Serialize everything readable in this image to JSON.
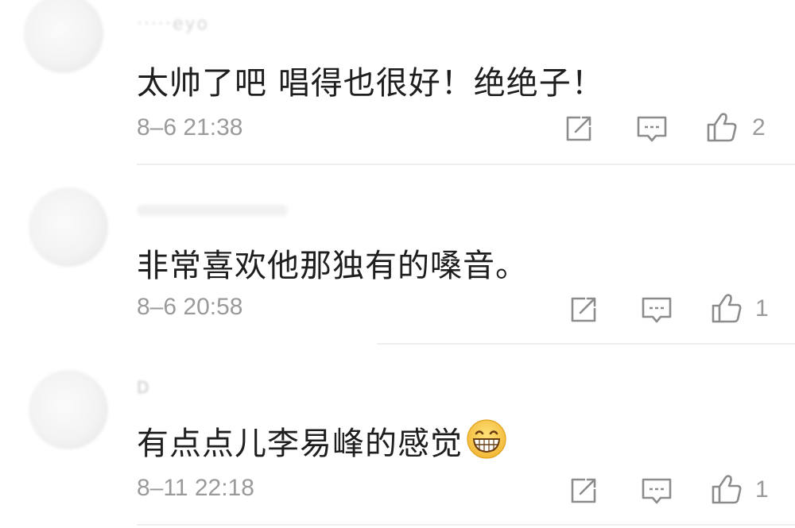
{
  "comments": [
    {
      "username": "·····eyo",
      "text": "太帅了吧 唱得也很好！绝绝子！",
      "timestamp": "8–6 21:38",
      "likes": "2",
      "emoji": null
    },
    {
      "username": "",
      "text": "非常喜欢他那独有的嗓音。",
      "timestamp": "8–6 20:58",
      "likes": "1",
      "emoji": null
    },
    {
      "username": "D",
      "text": "有点点儿李易峰的感觉",
      "timestamp": "8–11 22:18",
      "likes": "1",
      "emoji": "grinning-face-emoji"
    }
  ],
  "icons": {
    "share": "share-icon",
    "reply": "comment-icon",
    "like": "thumbs-up-icon"
  },
  "colors": {
    "text": "#1e1e1e",
    "meta": "#9a9a9a",
    "icon": "#8c8c8c",
    "divider": "#efefef",
    "emoji": "#f7c94a"
  }
}
